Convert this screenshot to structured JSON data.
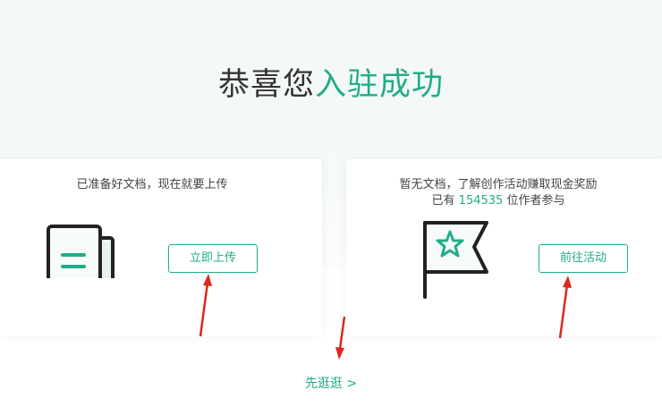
{
  "hero": {
    "title_prefix": "恭喜您",
    "title_accent": "入驻成功"
  },
  "upload_card": {
    "text": "已准备好文档，现在就要上传",
    "button_label": "立即上传",
    "icon": "document-icon"
  },
  "activity_card": {
    "line1": "暂无文档，了解创作活动赚取现金奖励",
    "line2_prefix": "已有 ",
    "participant_count": "154535",
    "line2_suffix": " 位作者参与",
    "button_label": "前往活动",
    "icon": "flag-star-icon"
  },
  "skip_link": {
    "label": "先逛逛 >"
  },
  "colors": {
    "accent": "#22ac89",
    "annotation_arrow": "#e0261d"
  }
}
